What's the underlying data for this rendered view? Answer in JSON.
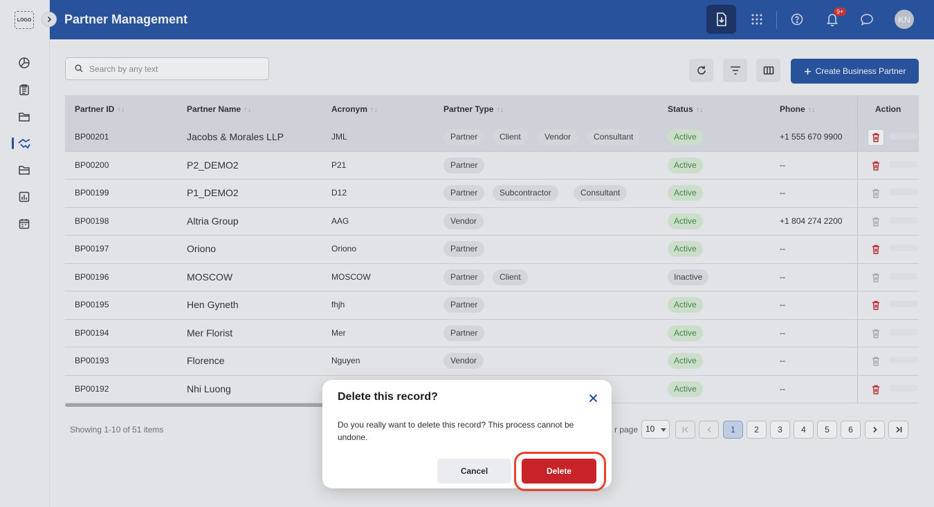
{
  "sidebar": {
    "logo": "LOGO",
    "items": [
      {
        "icon": "pie-chart-icon"
      },
      {
        "icon": "clipboard-icon"
      },
      {
        "icon": "folder-open-icon"
      },
      {
        "icon": "handshake-icon",
        "active": true
      },
      {
        "icon": "folder-icon"
      },
      {
        "icon": "report-chart-icon"
      },
      {
        "icon": "calendar-icon"
      }
    ]
  },
  "header": {
    "title": "Partner Management",
    "notification_badge": "9+",
    "avatar_initials": "KN"
  },
  "toolbar": {
    "search_placeholder": "Search by any text",
    "create_label": "Create Business Partner"
  },
  "table": {
    "columns": [
      "Partner ID",
      "Partner Name",
      "Acronym",
      "Partner Type",
      "Status",
      "Phone",
      "Action"
    ],
    "rows": [
      {
        "id": "BP00201",
        "name": "Jacobs & Morales LLP",
        "acronym": "JML",
        "types": [
          "Partner",
          "Client",
          "Vendor",
          "Consultant"
        ],
        "status": "Active",
        "phone": "+1 555 670 9900",
        "selected": true
      },
      {
        "id": "BP00200",
        "name": "P2_DEMO2",
        "acronym": "P21",
        "types": [
          "Partner"
        ],
        "status": "Active",
        "phone": "--"
      },
      {
        "id": "BP00199",
        "name": "P1_DEMO2",
        "acronym": "D12",
        "types": [
          "Partner",
          "Subcontractor",
          "Consultant"
        ],
        "status": "Active",
        "phone": "--"
      },
      {
        "id": "BP00198",
        "name": "Altria Group",
        "acronym": "AAG",
        "types": [
          "Vendor"
        ],
        "status": "Active",
        "phone": "+1 804 274 2200"
      },
      {
        "id": "BP00197",
        "name": "Oriono",
        "acronym": "Oriono",
        "types": [
          "Partner"
        ],
        "status": "Active",
        "phone": "--"
      },
      {
        "id": "BP00196",
        "name": "MOSCOW",
        "acronym": "MOSCOW",
        "types": [
          "Partner",
          "Client"
        ],
        "status": "Inactive",
        "phone": "--"
      },
      {
        "id": "BP00195",
        "name": "Hen Gyneth",
        "acronym": "fhjh",
        "types": [
          "Partner"
        ],
        "status": "Active",
        "phone": "--"
      },
      {
        "id": "BP00194",
        "name": "Mer Florist",
        "acronym": "Mer",
        "types": [
          "Partner"
        ],
        "status": "Active",
        "phone": "--"
      },
      {
        "id": "BP00193",
        "name": "Florence",
        "acronym": "Nguyen",
        "types": [
          "Vendor"
        ],
        "status": "Active",
        "phone": "--"
      },
      {
        "id": "BP00192",
        "name": "Nhi Luong",
        "acronym": "",
        "types": [],
        "status": "Active",
        "phone": "--"
      }
    ]
  },
  "pagination": {
    "showing": "Showing 1-10 of 51 items",
    "per_page_label": "r page",
    "per_page_value": "10",
    "pages": [
      "1",
      "2",
      "3",
      "4",
      "5",
      "6"
    ],
    "current": "1"
  },
  "dialog": {
    "title": "Delete this record?",
    "message": "Do you really want to delete this record? This process cannot be undone.",
    "cancel_label": "Cancel",
    "delete_label": "Delete"
  },
  "colors": {
    "brand": "#2350a3",
    "danger": "#c9232a",
    "active_status": "#3d8b3d"
  }
}
